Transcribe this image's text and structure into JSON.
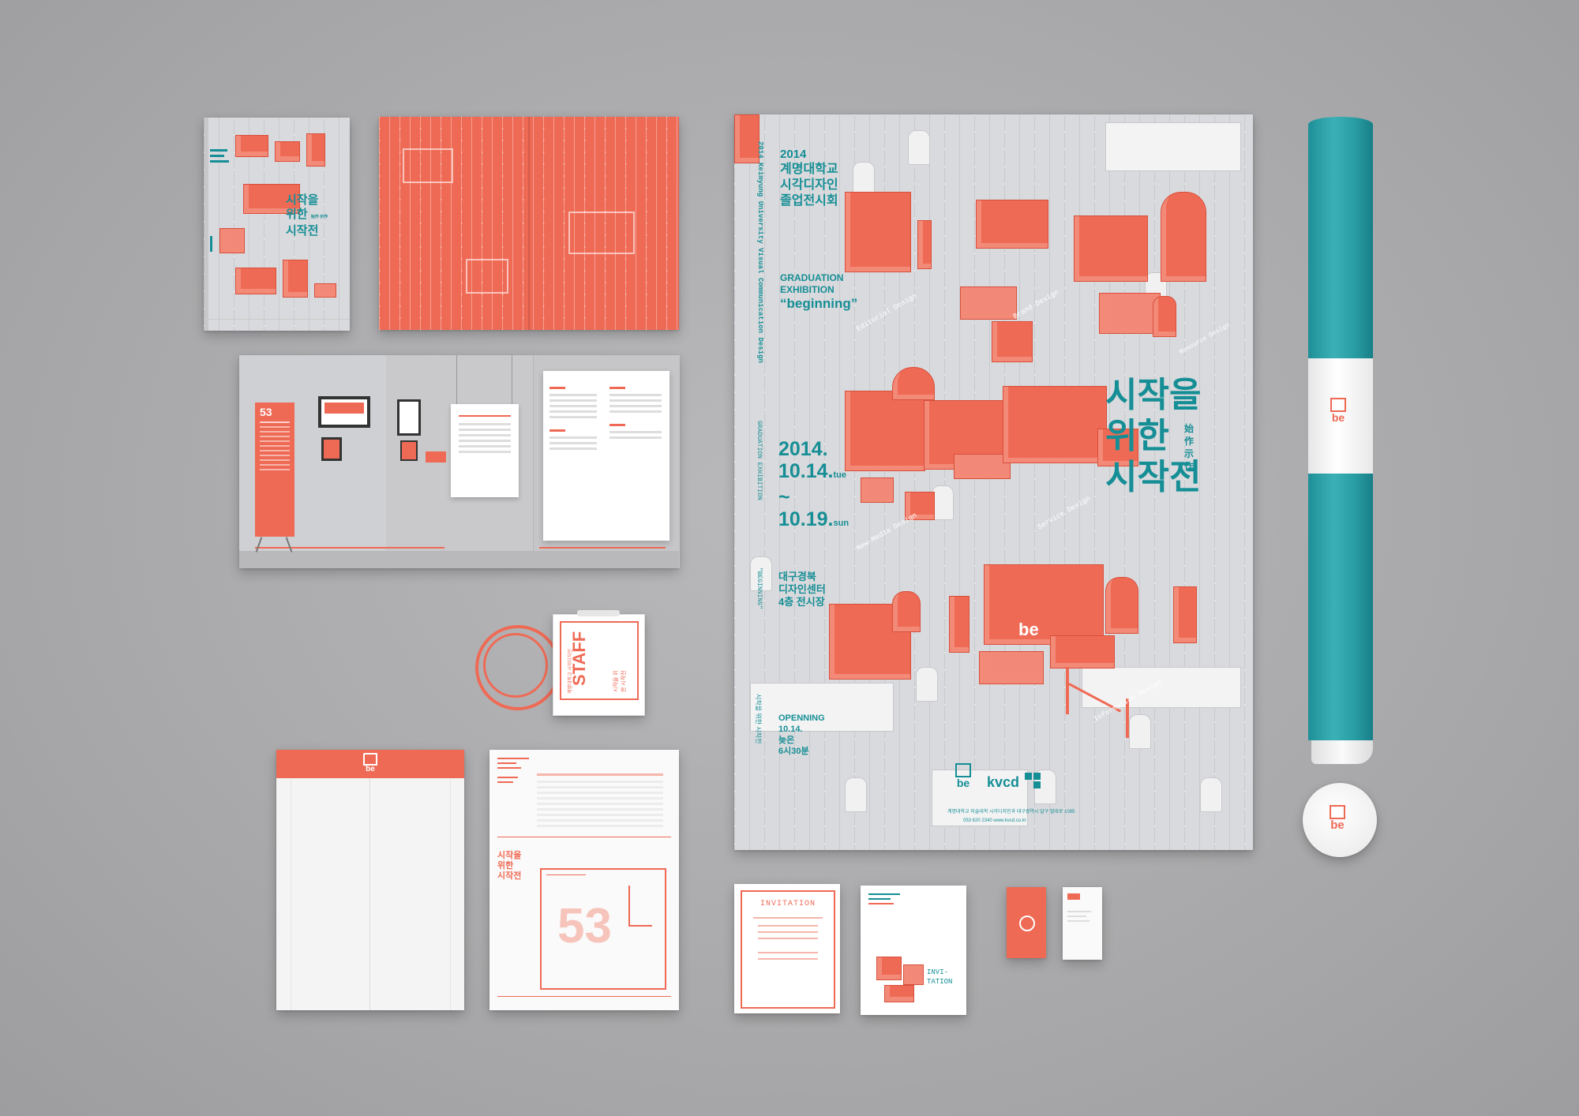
{
  "colors": {
    "accent_red": "#ef6a55",
    "accent_teal": "#158e95",
    "background": "#a9a9ab"
  },
  "book_cover": {
    "title_line1": "시작을",
    "title_line2": "위한",
    "title_line3": "시작전",
    "small_chars": "始作 示作"
  },
  "brochure": {
    "red_banner_number": "53"
  },
  "poster": {
    "year": "2014",
    "school_line1": "계명대학교",
    "school_line2": "시각디자인",
    "school_line3": "졸업전시회",
    "vertical_english": "2014 Keimyung University   Visual Communication Design",
    "vertical_english2": "GRADUATION EXHIBITION",
    "vertical_english3": "\"BEGINNING\"",
    "vertical_english4": "시작을 위한 시작전",
    "grad_line1": "GRADUATION",
    "grad_line2": "EXHIBITION",
    "grad_line3": "“beginning”",
    "date1_big": "2014.",
    "date2_big": "10.14.",
    "date2_day": "tue",
    "tilde": "~",
    "date3_big": "10.19.",
    "date3_day": "sun",
    "venue1": "대구경북",
    "venue2": "디자인센터",
    "venue3": "4층 전시장",
    "opening1": "OPENNING",
    "opening2": "10.14.",
    "opening3": "늦은",
    "opening4": "6시30분",
    "title1": "시작을",
    "title2": "위한",
    "title2_side1": "始作",
    "title2_side2": "示作",
    "title3": "시작전",
    "be_logo": "be",
    "kvcd_logo": "kvcd",
    "footer1": "계명대학교 미술대학 시각디자인과 대구광역시 달구 벌대로 1095",
    "footer2": "053 620 2340   www.kvcd.co.kr",
    "label_editorial": "Editorial Design",
    "label_newmedia": "New-Media Design",
    "label_service": "Service Design",
    "label_information": "Information Design",
    "label_brand": "Brand Design",
    "label_resource": "Resource Design"
  },
  "rolled_poster": {
    "logo": "be"
  },
  "badge": {
    "logo": "be"
  },
  "lanyard": {
    "staff": "STAFF",
    "sub1": "계명대학교 시각디자인",
    "sub2": "시작을 위한 시작전"
  },
  "envelope": {
    "logo": "be"
  },
  "letter": {
    "title1": "시작을",
    "title2": "위한",
    "title3": "시작전",
    "big_number": "53"
  },
  "invitation": {
    "label": "INVITATION"
  },
  "invitation2": {
    "label_part1": "INVI-",
    "label_part2": "TATION"
  }
}
